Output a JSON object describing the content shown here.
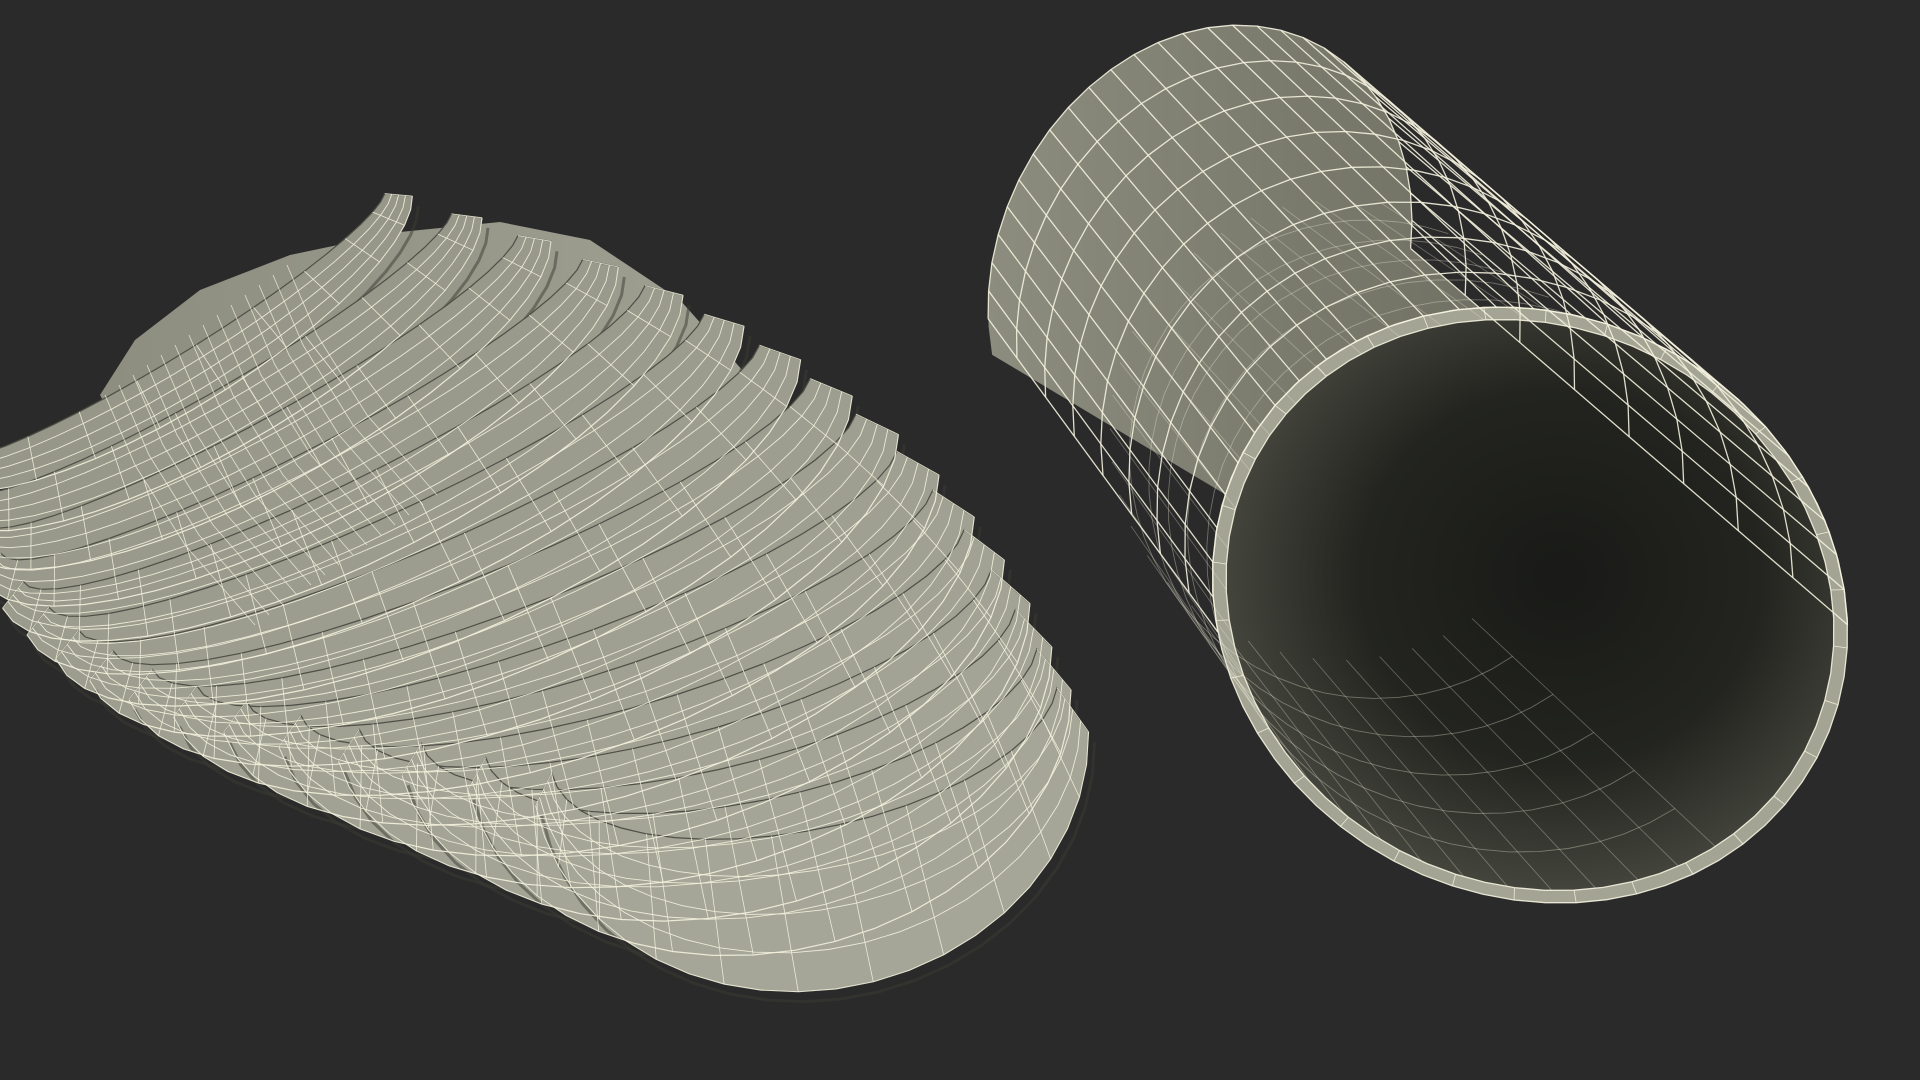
{
  "scene": {
    "background_color": "#2a2a2a",
    "surface_color": "#a6a797",
    "surface_shadow_color": "#5f6055",
    "interior_dark_color": "#1d1e1a",
    "wire_color": "#f4f2de",
    "objects": [
      {
        "name": "crumpled-sleeve-mesh",
        "kind": "accordion-folded tube",
        "fold_count": 16
      },
      {
        "name": "straight-sleeve-mesh",
        "kind": "open cylinder tube",
        "rings": 8,
        "segments": 28
      }
    ]
  }
}
